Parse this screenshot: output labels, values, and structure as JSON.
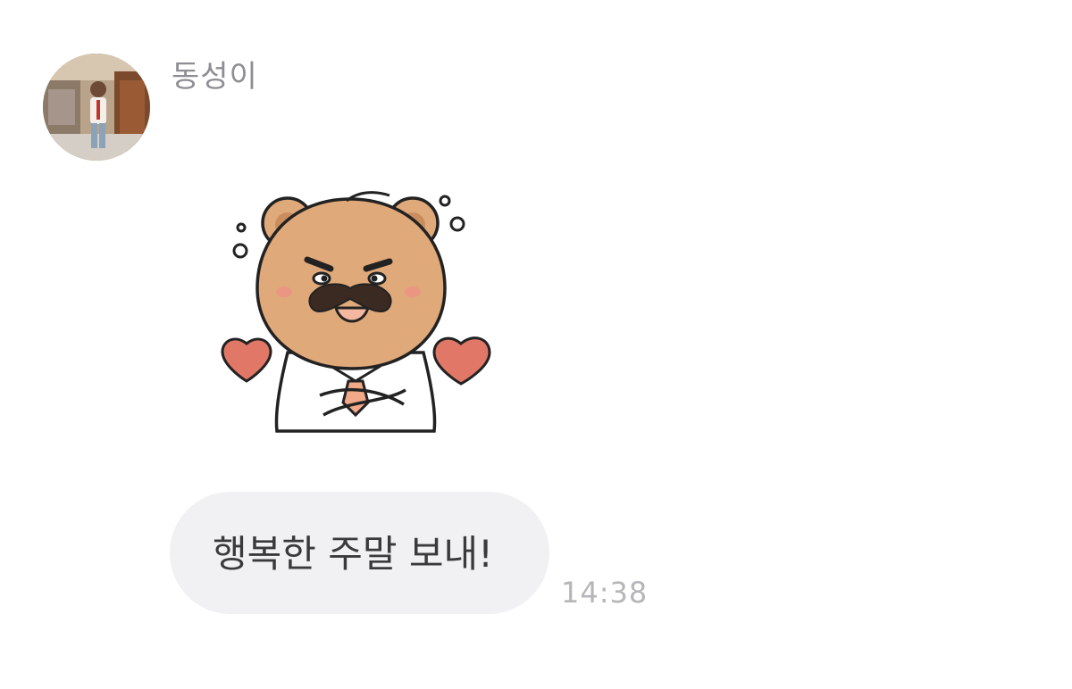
{
  "message": {
    "sender_name": "동성이",
    "avatar_icon": "profile-photo",
    "sticker_icon": "bear-mustache-hearts-sticker",
    "text": "행복한 주말 보내!",
    "timestamp": "14:38"
  },
  "colors": {
    "bubble_background": "#f1f1f3",
    "sender_name": "#8e8e93",
    "timestamp": "#b5b5ba",
    "bear_fur": "#e0a97a",
    "heart": "#e17766"
  }
}
